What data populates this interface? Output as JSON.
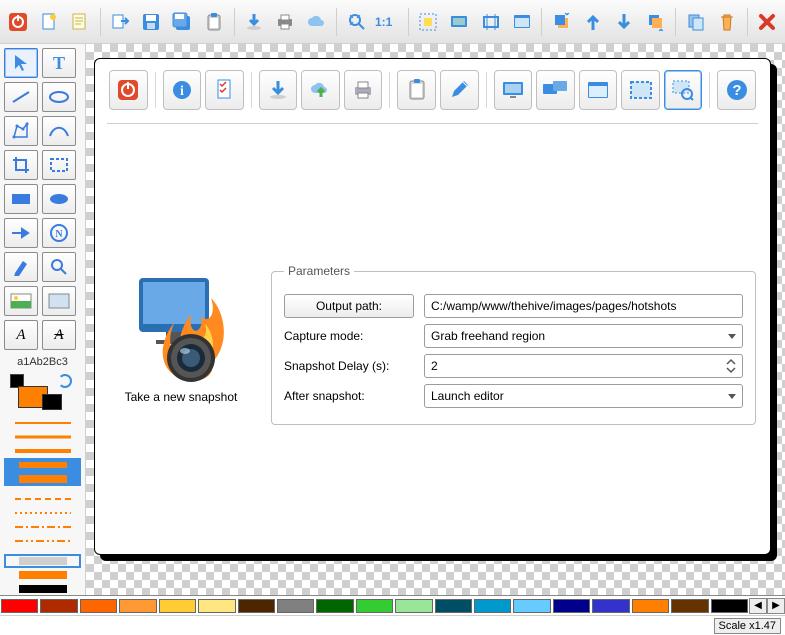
{
  "palette": {
    "colors": [
      "#ff0000",
      "#ae2b00",
      "#ff6600",
      "#ff9933",
      "#ffcc33",
      "#ffe680",
      "#4d2600",
      "#808080",
      "#006600",
      "#33cc33",
      "#99e699",
      "#004d66",
      "#0099cc",
      "#66ccff",
      "#00008b",
      "#3333cc",
      "#ff8000",
      "#663300",
      "#000000"
    ]
  },
  "sidebar": {
    "sample_text": "a1Ab2Bc3"
  },
  "status": {
    "scale": "Scale x1.47"
  },
  "snapshot": {
    "caption": "Take a new snapshot",
    "parameters_legend": "Parameters",
    "output_path_button": "Output path:",
    "output_path_value": "C:/wamp/www/thehive/images/pages/hotshots",
    "capture_mode_label": "Capture mode:",
    "capture_mode_value": "Grab freehand region",
    "delay_label": "Snapshot Delay (s):",
    "delay_value": "2",
    "after_label": "After snapshot:",
    "after_value": "Launch editor"
  }
}
